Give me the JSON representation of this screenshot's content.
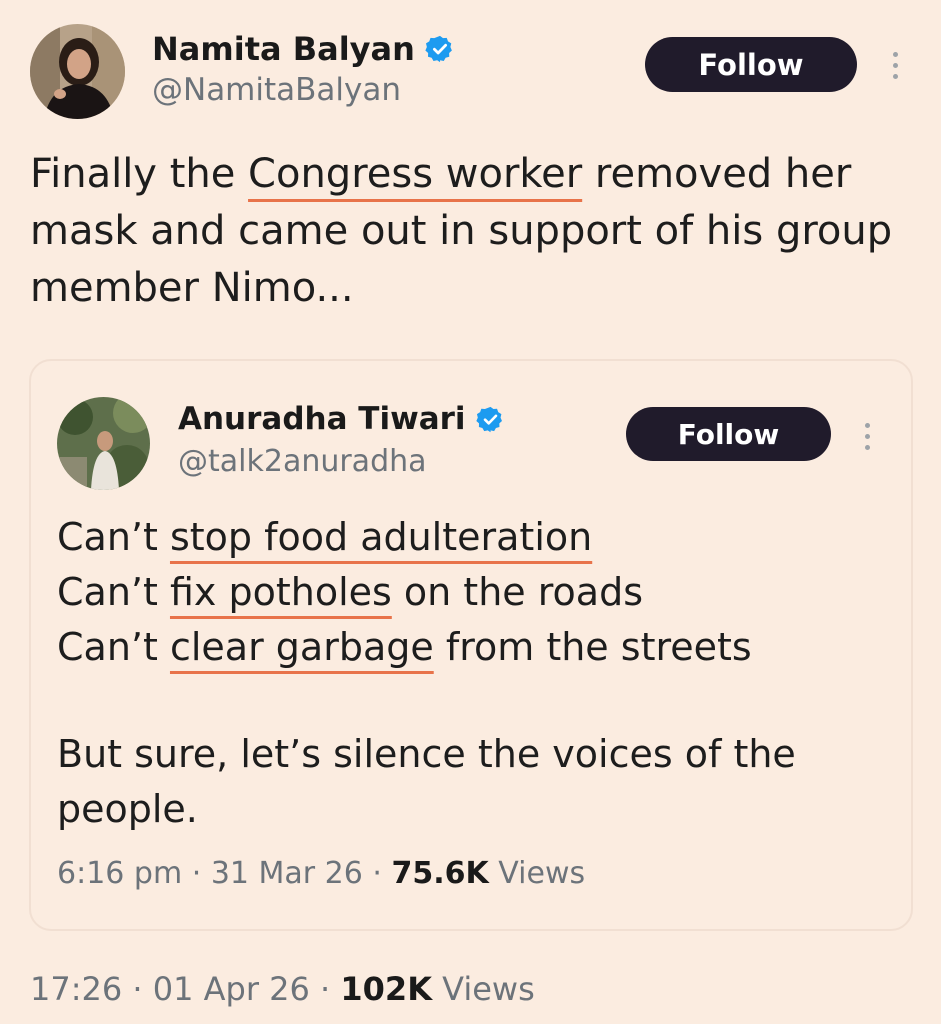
{
  "main_tweet": {
    "author_name": "Namita Balyan",
    "handle": "@NamitaBalyan",
    "follow_label": "Follow",
    "text_parts": {
      "before": "Finally the ",
      "highlight": "Congress worker",
      "after": " removed her mask and came out in support of his group member Nimo..."
    },
    "meta": {
      "time": "17:26",
      "date": "01 Apr 26",
      "views_count": "102K",
      "views_label": "Views",
      "separator": "·"
    }
  },
  "quoted_tweet": {
    "author_name": "Anuradha Tiwari",
    "handle": "@talk2anuradha",
    "follow_label": "Follow",
    "lines": [
      {
        "prefix": "Can’t ",
        "highlight": "stop food adulteration",
        "suffix": ""
      },
      {
        "prefix": "Can’t ",
        "highlight": "fix potholes",
        "suffix": " on the roads"
      },
      {
        "prefix": "Can’t ",
        "highlight": "clear garbage",
        "suffix": " from the streets"
      }
    ],
    "closing": "But sure, let’s silence the voices of the people.",
    "meta": {
      "time": "6:16 pm",
      "date": "31 Mar 26",
      "views_count": "75.6K",
      "views_label": "Views",
      "separator": "·"
    }
  },
  "icons": {
    "verified": "verified-badge-icon",
    "more": "more-vertical-icon"
  },
  "colors": {
    "background": "#fbece0",
    "follow_button": "#201b2b",
    "verified_badge": "#1d9bf0",
    "highlight_underline": "#e8734a",
    "secondary_text": "#6c737a"
  }
}
